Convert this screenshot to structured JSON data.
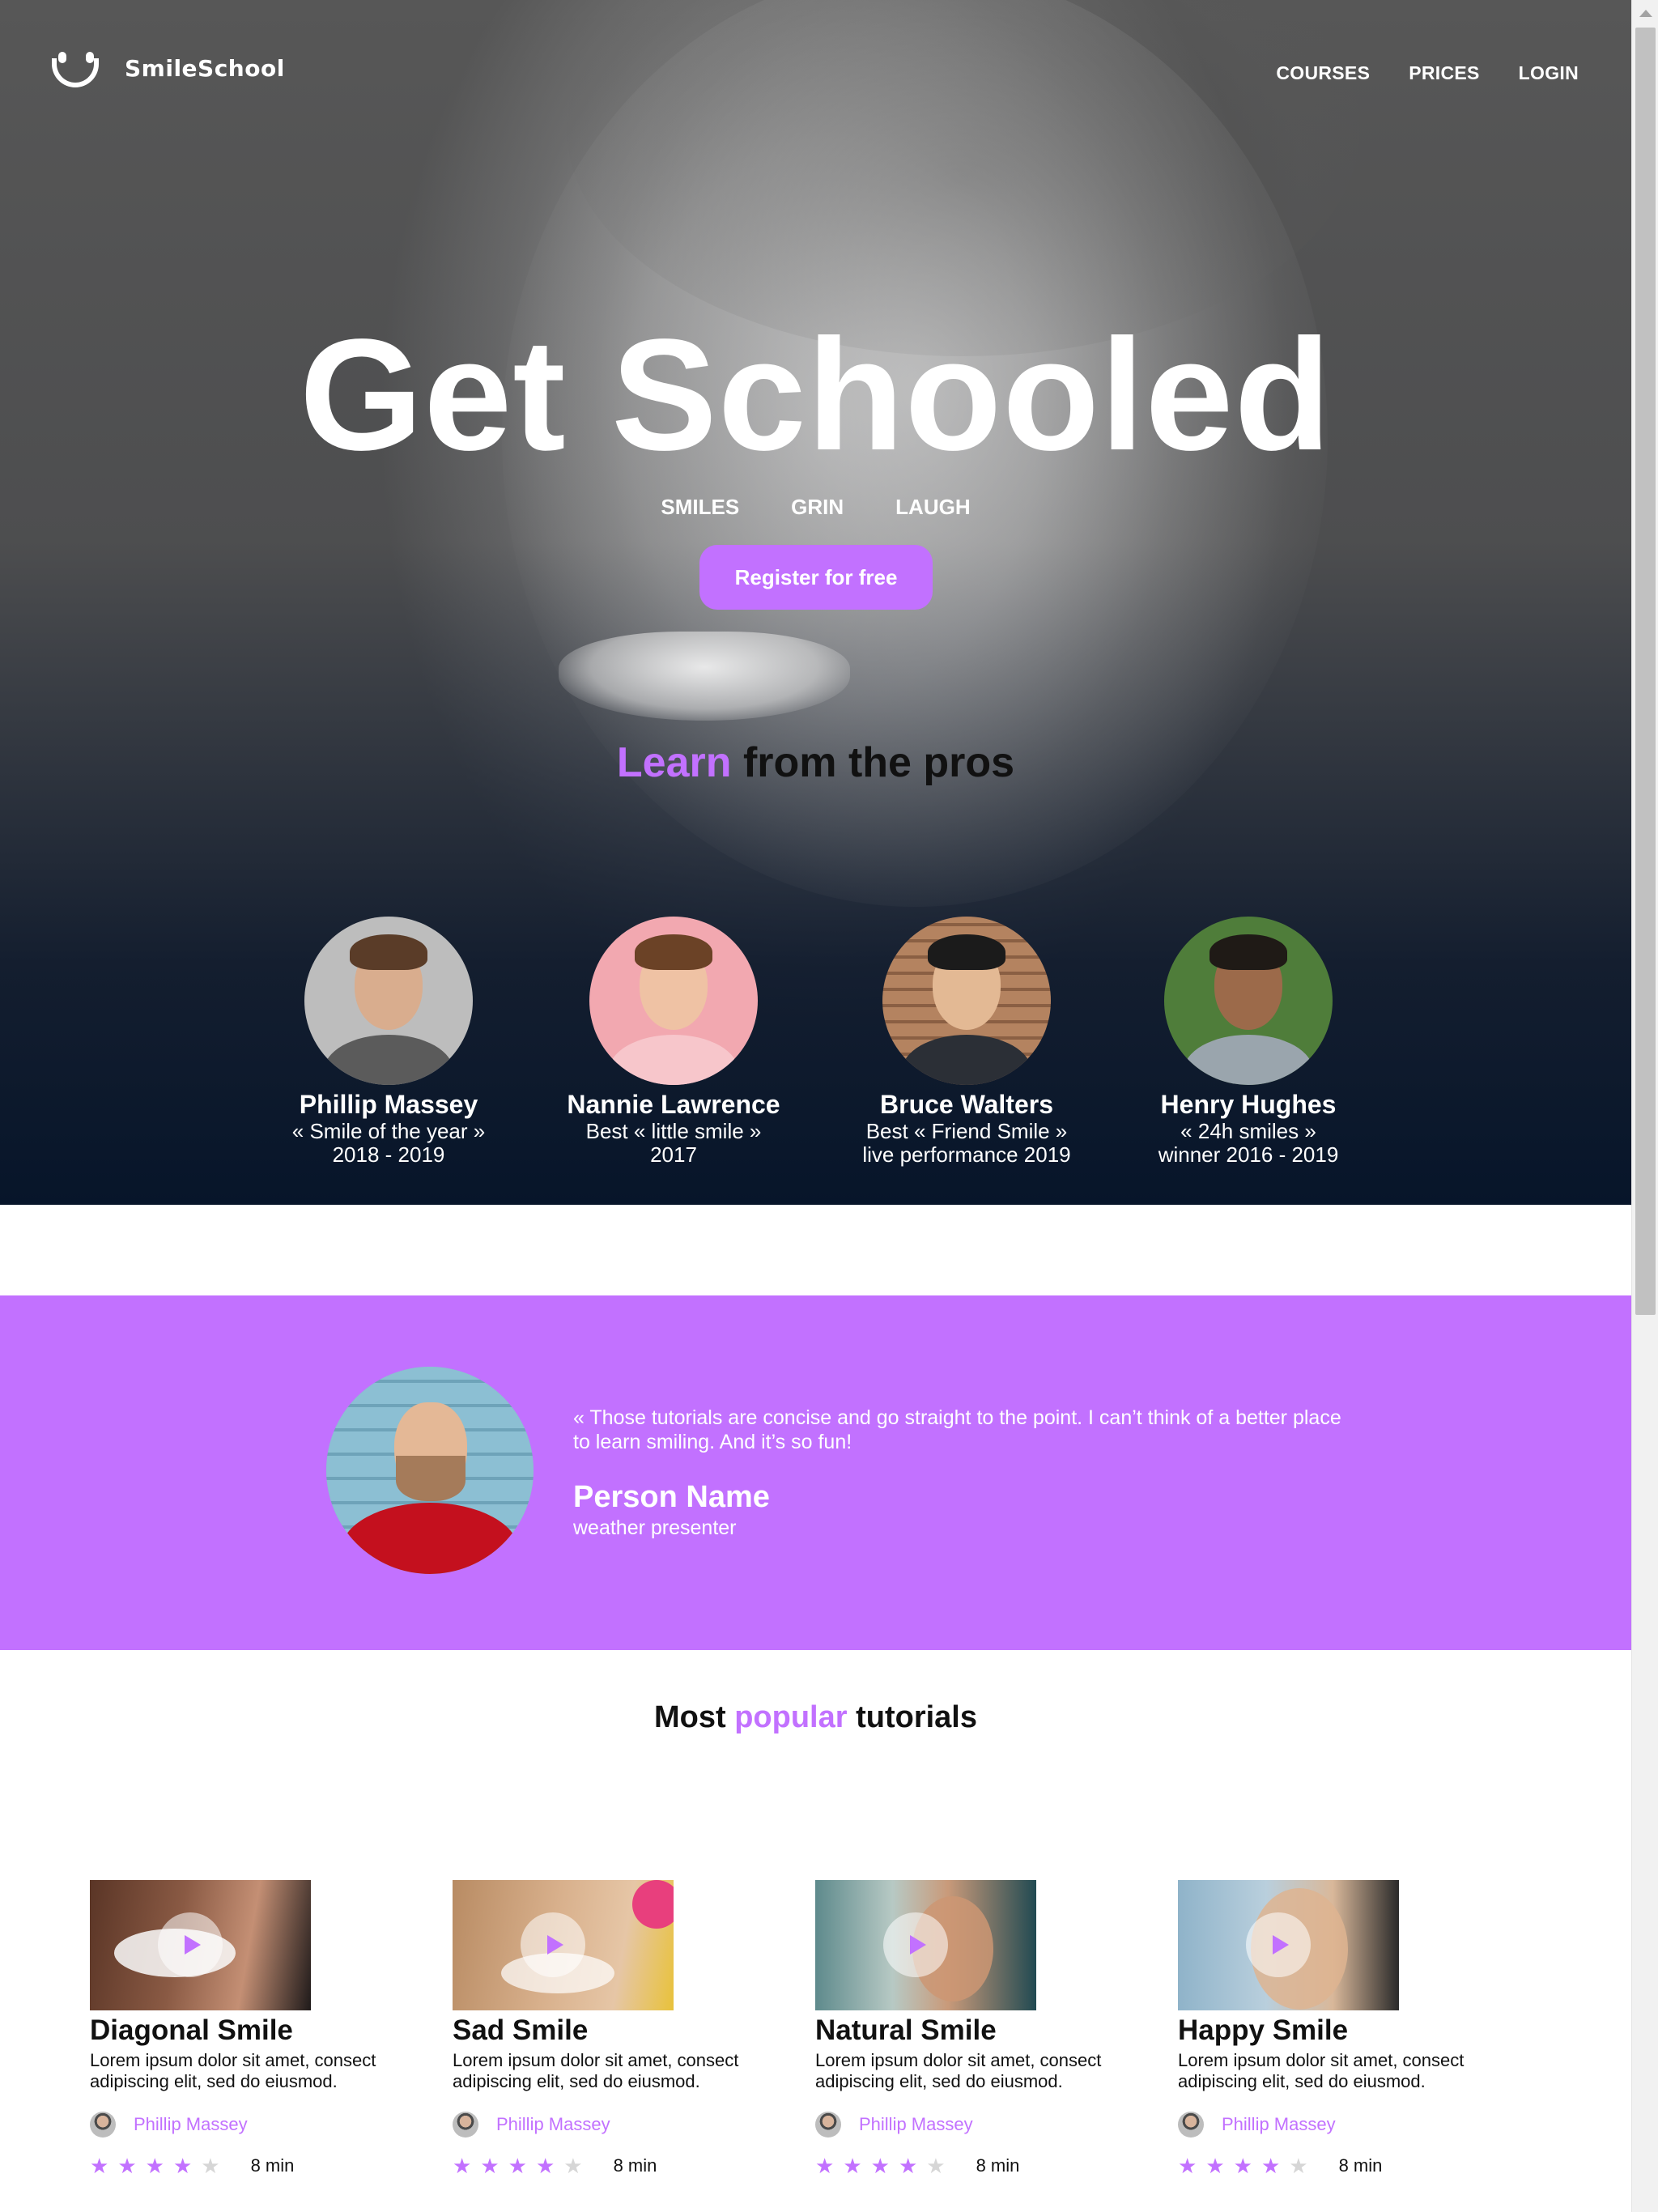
{
  "brand": {
    "name": "SmileSchool"
  },
  "nav": {
    "items": [
      "COURSES",
      "PRICES",
      "LOGIN"
    ]
  },
  "hero": {
    "title": "Get Schooled",
    "tags": [
      "SMILES",
      "GRIN",
      "LAUGH"
    ],
    "cta": "Register for free"
  },
  "learn": {
    "accent": "Learn",
    "rest": "from the pros"
  },
  "pros": [
    {
      "name": "Phillip Massey",
      "line1": "« Smile of the year »",
      "line2": "2018 - 2019"
    },
    {
      "name": "Nannie Lawrence",
      "line1": "Best « little smile »",
      "line2": "2017"
    },
    {
      "name": "Bruce Walters",
      "line1": "Best « Friend Smile »",
      "line2": "live performance 2019"
    },
    {
      "name": "Henry Hughes",
      "line1": "« 24h smiles »",
      "line2": "winner 2016 - 2019"
    }
  ],
  "testimonial": {
    "quote": "« Those tutorials are concise and go straight to the point. I can’t think of a better place to learn smiling. And it’s so fun!",
    "name": "Person Name",
    "role": "weather presenter"
  },
  "tutorials": {
    "heading": {
      "pre": "Most",
      "accent": "popular",
      "post": "tutorials"
    },
    "items": [
      {
        "title": "Diagonal Smile",
        "desc": "Lorem ipsum dolor sit amet, consect adipiscing elit, sed do eiusmod.",
        "author": "Phillip Massey",
        "rating": 4,
        "max_rating": 5,
        "duration": "8 min"
      },
      {
        "title": "Sad Smile",
        "desc": "Lorem ipsum dolor sit amet, consect adipiscing elit, sed do eiusmod.",
        "author": "Phillip Massey",
        "rating": 4,
        "max_rating": 5,
        "duration": "8 min"
      },
      {
        "title": "Natural Smile",
        "desc": "Lorem ipsum dolor sit amet, consect adipiscing elit, sed do eiusmod.",
        "author": "Phillip Massey",
        "rating": 4,
        "max_rating": 5,
        "duration": "8 min"
      },
      {
        "title": "Happy Smile",
        "desc": "Lorem ipsum dolor sit amet, consect adipiscing elit, sed do eiusmod.",
        "author": "Phillip Massey",
        "rating": 4,
        "max_rating": 5,
        "duration": "8 min"
      }
    ]
  },
  "colors": {
    "accent": "#c271ff",
    "hero_bottom": "#07152a",
    "star_off": "#d6d6d6"
  },
  "icons": {
    "logo": "smiley-face-icon",
    "play": "play-icon",
    "star": "star-icon"
  }
}
